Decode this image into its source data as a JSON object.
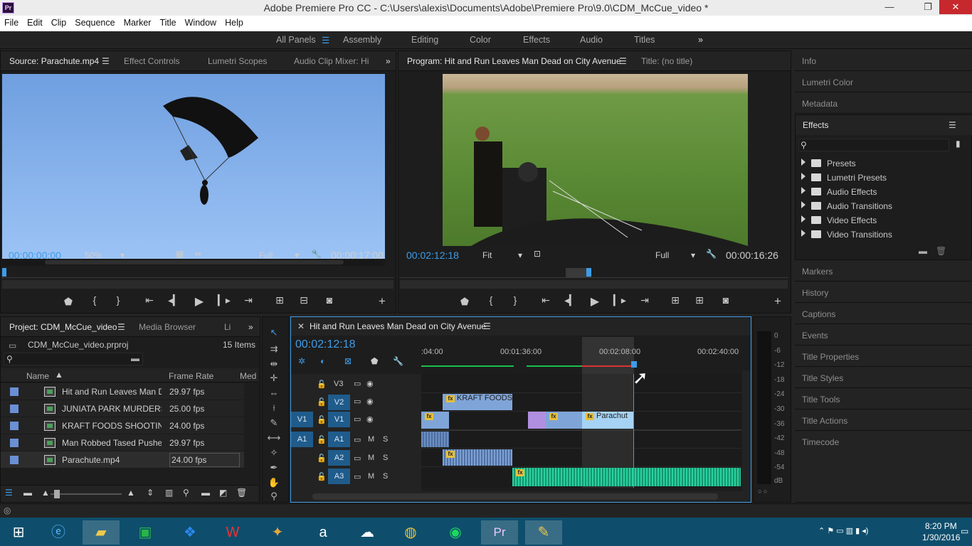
{
  "window": {
    "app_badge": "Pr",
    "title": "Adobe Premiere Pro CC - C:\\Users\\alexis\\Documents\\Adobe\\Premiere Pro\\9.0\\CDM_McCue_video *",
    "controls": {
      "minimize": "—",
      "maximize": "❐",
      "close": "✕"
    }
  },
  "menu": [
    "File",
    "Edit",
    "Clip",
    "Sequence",
    "Marker",
    "Title",
    "Window",
    "Help"
  ],
  "workspaces": {
    "all_panels": "All Panels",
    "items": [
      "Assembly",
      "Editing",
      "Color",
      "Effects",
      "Audio",
      "Titles"
    ],
    "more": "»"
  },
  "source": {
    "tabs": [
      "Source: Parachute.mp4",
      "Effect Controls",
      "Lumetri Scopes",
      "Audio Clip Mixer: Hi"
    ],
    "timecode_in": "00:00:00:00",
    "zoom": "50%",
    "quality": "Full",
    "duration": "00:00:17:00"
  },
  "program": {
    "tabs": [
      "Program: Hit and Run Leaves Man Dead on City Avenue",
      "Title: (no title)"
    ],
    "timecode": "00:02:12:18",
    "zoom": "Fit",
    "quality": "Full",
    "duration": "00:00:16:26"
  },
  "right_panels": {
    "top": [
      "Info",
      "Lumetri Color",
      "Metadata"
    ],
    "effects_title": "Effects",
    "effects_tree": [
      "Presets",
      "Lumetri Presets",
      "Audio Effects",
      "Audio Transitions",
      "Video Effects",
      "Video Transitions"
    ],
    "bottom": [
      "Markers",
      "History",
      "Captions",
      "Events",
      "Title Properties",
      "Title Styles",
      "Title Tools",
      "Title Actions",
      "Timecode"
    ]
  },
  "project": {
    "tabs": [
      "Project: CDM_McCue_video",
      "Media Browser",
      "Li"
    ],
    "file": "CDM_McCue_video.prproj",
    "count": "15 Items",
    "columns": {
      "name": "Name",
      "frame_rate": "Frame Rate",
      "media": "Med"
    },
    "rows": [
      {
        "name": "Hit and Run Leaves Man De",
        "fps": "29.97 fps"
      },
      {
        "name": "JUNIATA PARK MURDERS -",
        "fps": "25.00 fps"
      },
      {
        "name": "KRAFT FOODS SHOOTING-",
        "fps": "24.00 fps"
      },
      {
        "name": "Man Robbed Tased Pushed",
        "fps": "29.97 fps"
      },
      {
        "name": "Parachute.mp4",
        "fps": "24.00 fps"
      }
    ]
  },
  "timeline": {
    "sequence": "Hit and Run Leaves Man Dead on City Avenue",
    "timecode": "00:02:12:18",
    "ruler": [
      ":04:00",
      "00:01:36:00",
      "00:02:08:00",
      "00:02:40:00"
    ],
    "tracks": {
      "video": [
        "V3",
        "V2",
        "V1"
      ],
      "audio": [
        "A1",
        "A2",
        "A3"
      ],
      "source_v": "V1",
      "source_a": "A1",
      "mute": "M",
      "solo": "S"
    },
    "clips": {
      "kraft": "KRAFT FOODS",
      "parachute": "Parachut",
      "fx": "fx"
    }
  },
  "audio_meter": {
    "scale": [
      "0",
      "-6",
      "-12",
      "-18",
      "-24",
      "-30",
      "-36",
      "-42",
      "-48",
      "-54",
      "dB"
    ],
    "solo_buttons": "○ ○"
  },
  "taskbar": {
    "time": "8:20 PM",
    "date": "1/30/2016",
    "premiere_badge": "Pr"
  }
}
